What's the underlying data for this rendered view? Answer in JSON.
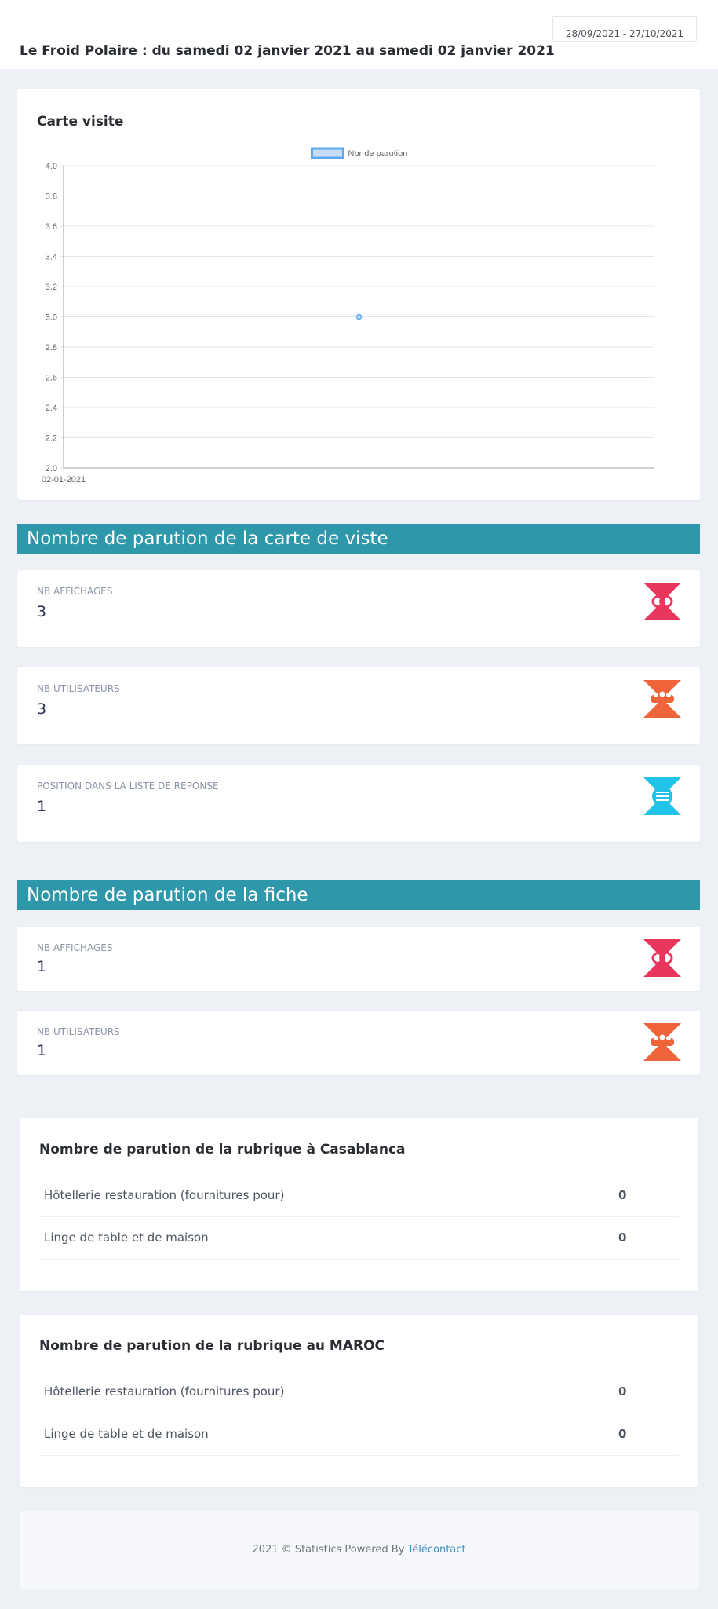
{
  "header": {
    "title": "Le Froid Polaire : du samedi 02 janvier 2021 au samedi 02 janvier 2021",
    "date_range": "28/09/2021 - 27/10/2021"
  },
  "chart_card": {
    "title": "Carte visite"
  },
  "chart_data": {
    "type": "line",
    "title": "",
    "xlabel": "",
    "ylabel": "",
    "x": [
      "02-01-2021"
    ],
    "series": [
      {
        "name": "Nbr de parution",
        "values": [
          3
        ]
      }
    ],
    "ylim": [
      2.0,
      4.0
    ],
    "yticks": [
      "4.0",
      "3.8",
      "3.6",
      "3.4",
      "3.2",
      "3.0",
      "2.8",
      "2.6",
      "2.4",
      "2.2",
      "2.0"
    ],
    "grid": true,
    "legend": "top-center",
    "colors": {
      "line": "#5ea8f0",
      "fill": "#c6dcf7",
      "grid": "#e2e4e8",
      "axis": "#9aa0a6",
      "tick_text": "#666666"
    }
  },
  "section_carte": {
    "title": "Nombre de parution de la carte de viste",
    "stats": [
      {
        "label": "NB AFFICHAGES",
        "value": "3",
        "icon": "eye-icon"
      },
      {
        "label": "NB UTILISATEURS",
        "value": "3",
        "icon": "users-icon"
      },
      {
        "label": "POSITION DANS LA LISTE DE RÉPONSE",
        "value": "1",
        "icon": "list-icon"
      }
    ]
  },
  "section_fiche": {
    "title": "Nombre de parution de la fiche",
    "stats": [
      {
        "label": "NB AFFICHAGES",
        "value": "1",
        "icon": "eye-icon"
      },
      {
        "label": "NB UTILISATEURS",
        "value": "1",
        "icon": "users-icon"
      }
    ]
  },
  "rubrique_casablanca": {
    "title": "Nombre de parution de la rubrique à Casablanca",
    "rows": [
      {
        "name": "Hôtellerie restauration (fournitures pour)",
        "count": "0"
      },
      {
        "name": "Linge de table et de maison",
        "count": "0"
      }
    ]
  },
  "rubrique_maroc": {
    "title": "Nombre de parution de la rubrique au MAROC",
    "rows": [
      {
        "name": "Hôtellerie restauration (fournitures pour)",
        "count": "0"
      },
      {
        "name": "Linge de table et de maison",
        "count": "0"
      }
    ]
  },
  "footer": {
    "text": "2021 © Statistics Powered By ",
    "link": "Télécontact"
  },
  "colors": {
    "band": "#2e98aa",
    "eye_icon": "#e8365d",
    "users_icon": "#f0643c",
    "list_icon": "#21c4e6"
  }
}
